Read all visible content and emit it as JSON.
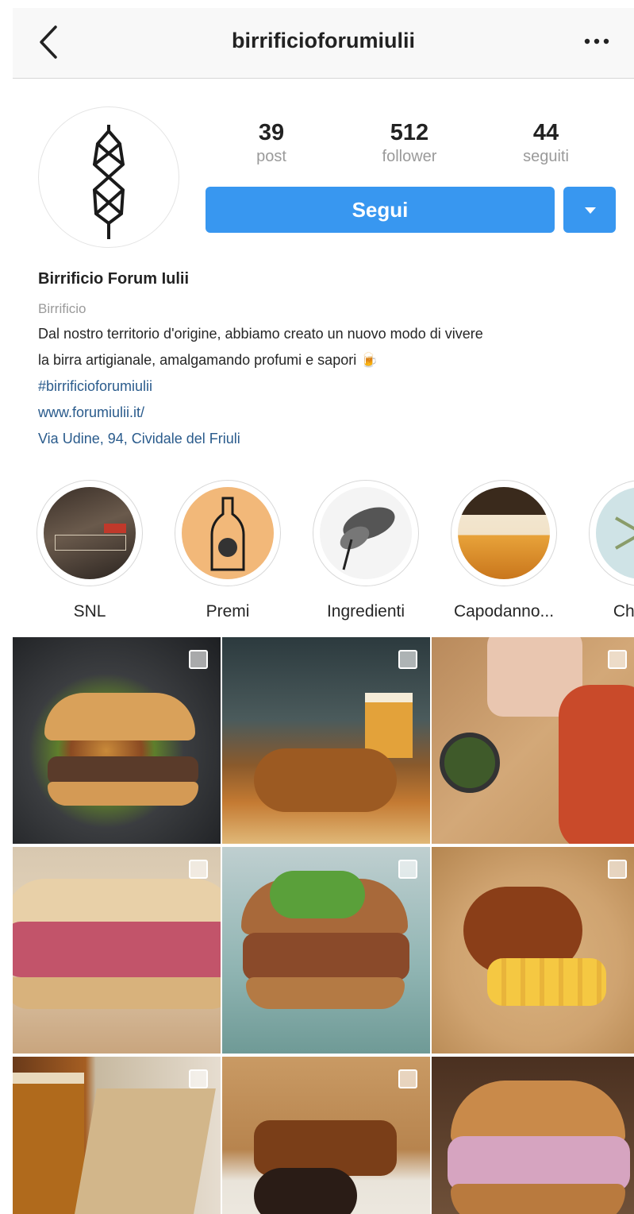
{
  "nav": {
    "username": "birrificioforumiulii"
  },
  "stats": [
    {
      "value": "39",
      "label": "post"
    },
    {
      "value": "512",
      "label": "follower"
    },
    {
      "value": "44",
      "label": "seguiti"
    }
  ],
  "actions": {
    "follow_label": "Segui"
  },
  "bio": {
    "name": "Birrificio Forum Iulii",
    "category": "Birrificio",
    "description_line1": "Dal nostro territorio d'origine, abbiamo creato un nuovo modo di vivere",
    "description_line2": "la birra artigianale, amalgamando profumi e sapori 🍺",
    "hashtag": "#birrificioforumiulii",
    "website": "www.forumiulii.it/",
    "address": "Via Udine, 94, Cividale del Friuli"
  },
  "highlights": [
    {
      "label": "SNL"
    },
    {
      "label": "Premi"
    },
    {
      "label": "Ingredienti"
    },
    {
      "label": "Capodanno..."
    },
    {
      "label": "Christm"
    }
  ],
  "colors": {
    "accent": "#3897f0",
    "link": "#2a5b8c"
  }
}
